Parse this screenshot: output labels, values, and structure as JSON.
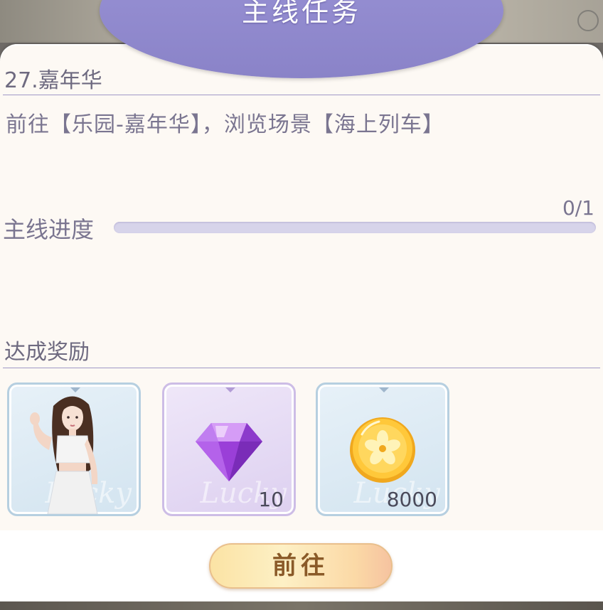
{
  "header": {
    "title": "主线任务"
  },
  "task": {
    "title": "27.嘉年华",
    "description": "前往【乐园-嘉年华】，浏览场景【海上列车】"
  },
  "progress": {
    "label": "主线进度",
    "count_text": "0/1",
    "value": 0,
    "max": 1
  },
  "rewards": {
    "label": "达成奖励",
    "items": [
      {
        "icon": "outfit-character-icon",
        "quantity": "",
        "frame": "blue"
      },
      {
        "icon": "purple-diamond-icon",
        "quantity": "10",
        "frame": "purple"
      },
      {
        "icon": "gold-sakura-coin-icon",
        "quantity": "8000",
        "frame": "blue"
      }
    ]
  },
  "actions": {
    "go_label": "前往"
  },
  "colors": {
    "accent": "#9a93d6",
    "panel": "#fdf9f4",
    "button": "#fbe3a4",
    "text": "#7a7590"
  }
}
